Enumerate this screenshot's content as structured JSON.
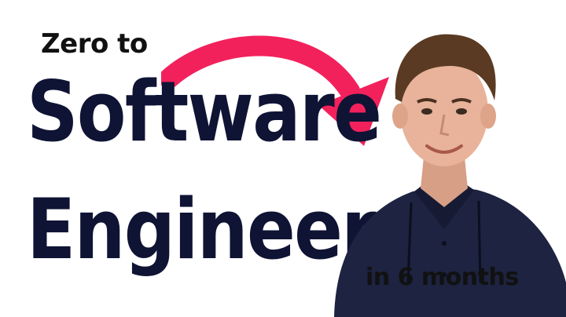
{
  "headline": {
    "prefix": "Zero to",
    "line_1": "Software",
    "line_2": "Engineer"
  },
  "tagline": "in 6 months",
  "colors": {
    "background": "#ffffff",
    "headline": "#0f1334",
    "prefix": "#111111",
    "arrow": "#f2215c",
    "shirt": "#1d2340",
    "hair": "#5a3a22",
    "skin": "#e8b39a"
  },
  "icons": {
    "arrow": "curved-arrow-icon"
  }
}
